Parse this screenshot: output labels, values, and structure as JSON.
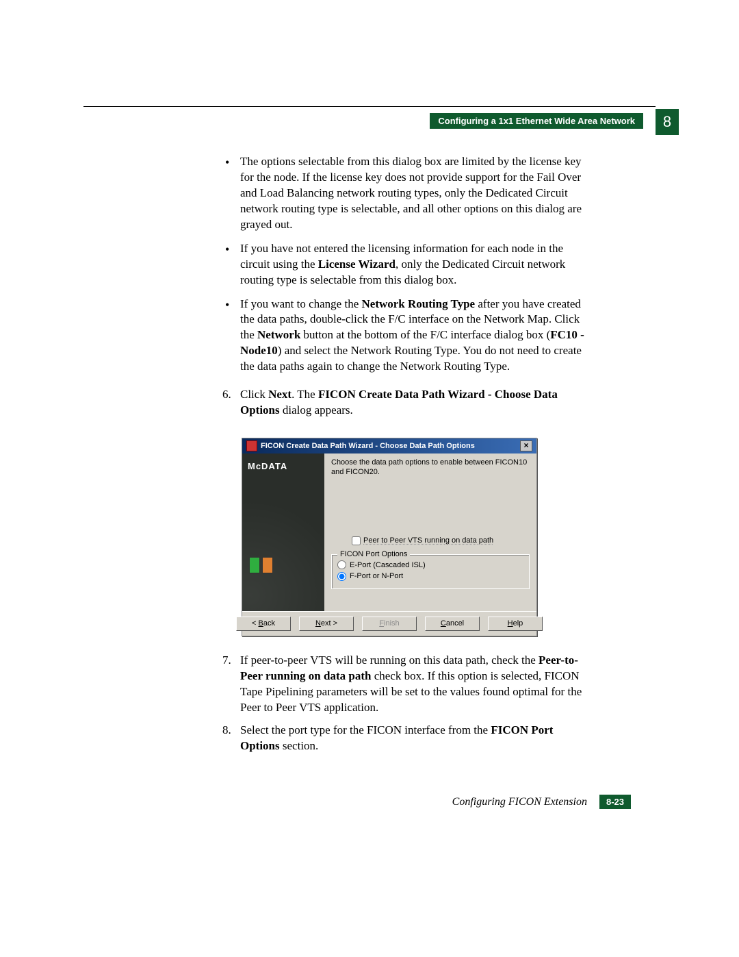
{
  "header": {
    "section_title": "Configuring a 1x1 Ethernet Wide Area Network",
    "chapter_number": "8"
  },
  "bullets": [
    "The options selectable from this dialog box are limited by the license key for the node. If the license key does not provide support for the Fail Over and Load Balancing network routing types, only the Dedicated Circuit network routing type is selectable, and all other options on this dialog are grayed out.",
    "If you have not entered the licensing information for each node in the circuit using the <b>License Wizard</b>, only the Dedicated Circuit network routing type is selectable from this dialog box.",
    "If you want to change the <b>Network Routing Type</b> after you have created the data paths, double-click the F/C interface on the Network Map. Click the <b>Network</b> button at the bottom of the F/C interface dialog box (<b>FC10 - Node10</b>) and select the Network Routing Type. You do not need to create the data paths again to change the Network Routing Type."
  ],
  "steps": {
    "s6": {
      "num": "6.",
      "html": "Click <b>Next</b>. The <b>FICON Create Data Path Wizard - Choose Data Options</b> dialog appears."
    },
    "s7": {
      "num": "7.",
      "html": "If peer-to-peer VTS will be running on this data path, check the <b>Peer-to-Peer running on data path</b> check box. If this option is selected, FICON Tape Pipelining parameters will be set to the values found optimal for the Peer to Peer VTS application."
    },
    "s8": {
      "num": "8.",
      "html": "Select the port type for the FICON interface from the <b>FICON Port Options</b> section."
    }
  },
  "dialog": {
    "title": "FICON Create Data Path Wizard - Choose Data Path Options",
    "brand": "McDATA",
    "intro": "Choose the data path options to enable between FICON10 and FICON20.",
    "checkbox_label": "Peer to Peer VTS running on data path",
    "fieldset_legend": "FICON Port Options",
    "radio1": "E-Port (Cascaded ISL)",
    "radio2": "F-Port or N-Port",
    "buttons": {
      "back": "< Back",
      "next": "Next >",
      "finish": "Finish",
      "cancel": "Cancel",
      "help": "Help"
    }
  },
  "footer": {
    "doc_title": "Configuring FICON Extension",
    "page_ref": "8-23"
  }
}
